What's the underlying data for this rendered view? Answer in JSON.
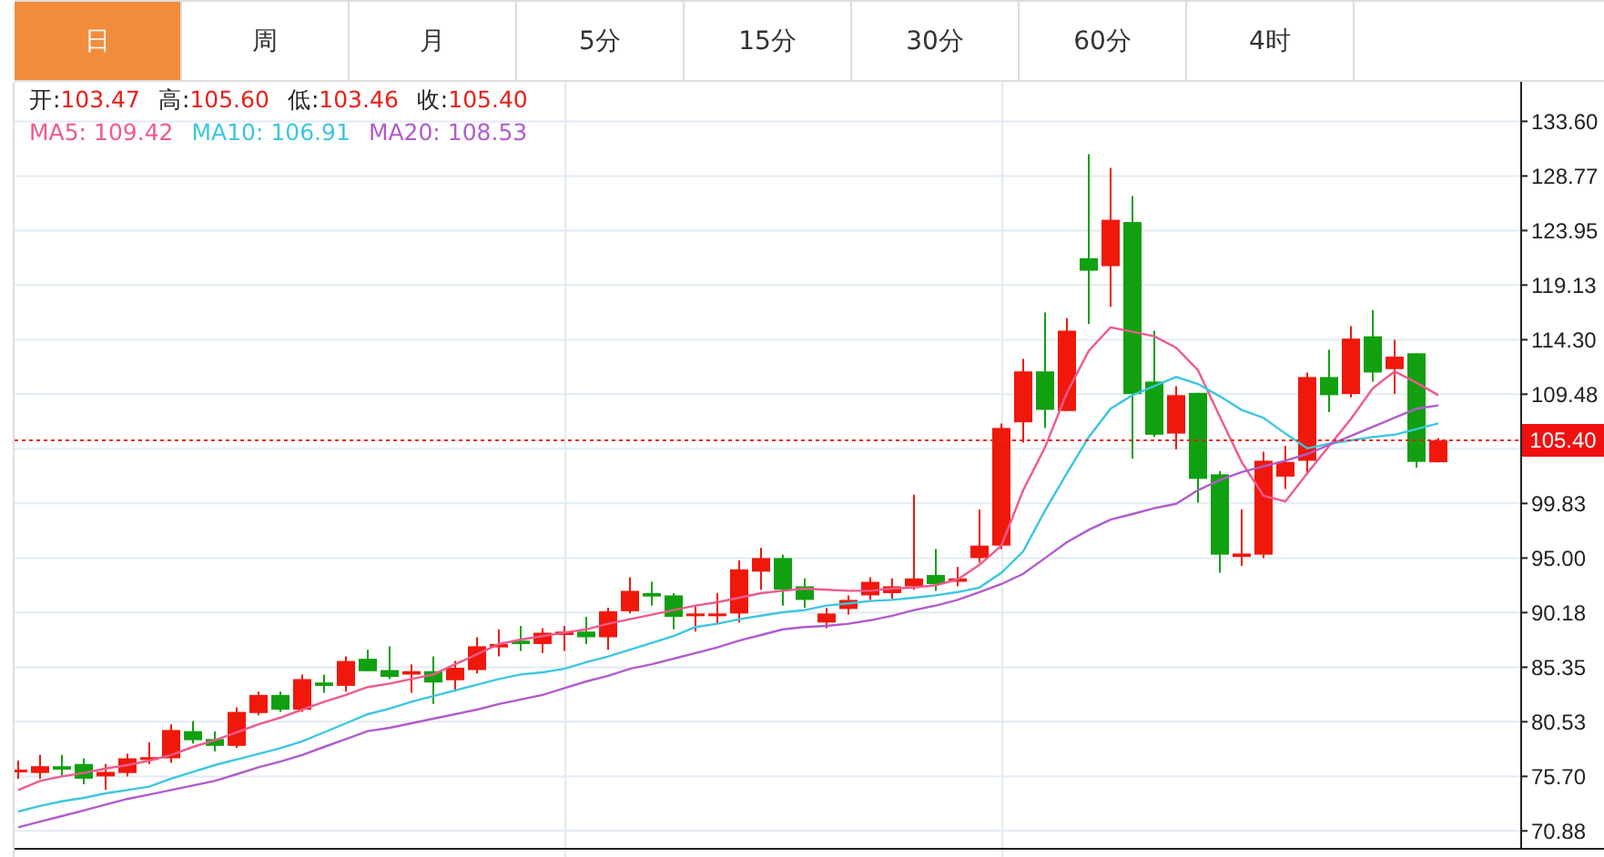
{
  "tabs": [
    {
      "label": "日",
      "selected": true
    },
    {
      "label": "周",
      "selected": false
    },
    {
      "label": "月",
      "selected": false
    },
    {
      "label": "5分",
      "selected": false
    },
    {
      "label": "15分",
      "selected": false
    },
    {
      "label": "30分",
      "selected": false
    },
    {
      "label": "60分",
      "selected": false
    },
    {
      "label": "4时",
      "selected": false
    }
  ],
  "ohlc": [
    {
      "label": "开:",
      "value": "103.47"
    },
    {
      "label": "高:",
      "value": "105.60"
    },
    {
      "label": "低:",
      "value": "103.46"
    },
    {
      "label": "收:",
      "value": "105.40"
    }
  ],
  "ma": [
    {
      "label": "MA5:",
      "value": "109.42",
      "color": "#ee5a8e"
    },
    {
      "label": "MA10:",
      "value": "106.91",
      "color": "#3cc6e0"
    },
    {
      "label": "MA20:",
      "value": "108.53",
      "color": "#b05ccc"
    }
  ],
  "chart": {
    "current_price": "105.40",
    "chart_data": {
      "type": "candlestick",
      "grid": true,
      "categories": [
        null,
        null,
        null,
        null,
        null,
        null,
        null,
        null,
        null,
        null,
        null,
        null,
        null,
        null,
        null,
        null,
        null,
        null,
        null,
        null,
        null,
        null,
        null,
        null,
        null,
        null,
        null,
        null,
        null,
        null,
        null,
        null,
        null,
        null,
        null,
        null,
        null,
        null,
        null,
        null,
        null,
        null,
        null,
        null,
        null,
        null,
        null,
        null,
        null,
        null,
        null,
        null,
        null,
        null,
        null,
        null,
        null,
        null,
        null,
        null,
        null,
        null,
        null,
        null,
        null,
        null
      ],
      "ohlc": [
        [
          76.1,
          77.1,
          75.5,
          76.3
        ],
        [
          76.0,
          77.6,
          75.5,
          76.6
        ],
        [
          76.6,
          77.6,
          75.8,
          76.3
        ],
        [
          76.8,
          77.3,
          75.0,
          75.5
        ],
        [
          75.7,
          76.8,
          74.5,
          76.1
        ],
        [
          76.0,
          77.7,
          75.7,
          77.3
        ],
        [
          77.3,
          78.7,
          76.8,
          77.4
        ],
        [
          77.3,
          80.3,
          76.9,
          79.8
        ],
        [
          79.7,
          80.6,
          78.6,
          78.9
        ],
        [
          79.0,
          79.7,
          77.9,
          78.4
        ],
        [
          78.4,
          81.8,
          78.2,
          81.4
        ],
        [
          81.3,
          83.2,
          81.1,
          82.9
        ],
        [
          82.9,
          83.2,
          81.4,
          81.6
        ],
        [
          81.6,
          84.7,
          81.4,
          84.3
        ],
        [
          84.0,
          84.7,
          83.1,
          83.7
        ],
        [
          83.7,
          86.3,
          83.2,
          85.9
        ],
        [
          86.1,
          86.9,
          85.0,
          85.0
        ],
        [
          85.1,
          87.2,
          84.3,
          84.5
        ],
        [
          84.7,
          85.6,
          83.1,
          85.0
        ],
        [
          85.0,
          86.3,
          82.1,
          84.0
        ],
        [
          84.2,
          85.9,
          83.2,
          85.3
        ],
        [
          85.1,
          88.0,
          84.8,
          87.2
        ],
        [
          87.1,
          88.7,
          86.3,
          87.4
        ],
        [
          87.7,
          89.0,
          86.8,
          87.4
        ],
        [
          87.4,
          88.8,
          86.6,
          88.4
        ],
        [
          88.2,
          89.0,
          86.8,
          88.5
        ],
        [
          88.5,
          89.8,
          87.4,
          88.0
        ],
        [
          88.0,
          90.6,
          86.9,
          90.3
        ],
        [
          90.3,
          93.3,
          90.1,
          92.1
        ],
        [
          91.9,
          92.9,
          90.8,
          91.6
        ],
        [
          91.7,
          91.9,
          88.7,
          89.8
        ],
        [
          90.0,
          90.8,
          88.5,
          90.1
        ],
        [
          90.0,
          91.9,
          89.2,
          90.1
        ],
        [
          90.1,
          94.8,
          89.3,
          94.0
        ],
        [
          93.8,
          95.9,
          92.2,
          95.0
        ],
        [
          95.0,
          95.3,
          90.8,
          92.2
        ],
        [
          92.5,
          93.2,
          90.6,
          91.3
        ],
        [
          89.3,
          90.6,
          88.8,
          90.1
        ],
        [
          90.5,
          91.7,
          90.0,
          91.3
        ],
        [
          91.7,
          93.3,
          91.3,
          92.9
        ],
        [
          91.9,
          93.2,
          91.4,
          92.5
        ],
        [
          92.5,
          100.6,
          92.2,
          93.2
        ],
        [
          93.5,
          95.8,
          92.1,
          92.7
        ],
        [
          92.9,
          94.2,
          92.5,
          93.2
        ],
        [
          95.0,
          99.3,
          94.6,
          96.1
        ],
        [
          96.1,
          106.9,
          95.8,
          106.5
        ],
        [
          107.0,
          112.6,
          105.2,
          111.5
        ],
        [
          111.5,
          116.7,
          106.5,
          108.1
        ],
        [
          108.0,
          116.2,
          108.0,
          115.1
        ],
        [
          121.5,
          130.7,
          115.7,
          120.4
        ],
        [
          120.8,
          129.5,
          117.2,
          124.9
        ],
        [
          124.7,
          127.0,
          103.8,
          109.5
        ],
        [
          110.6,
          115.1,
          105.7,
          105.9
        ],
        [
          106.0,
          110.2,
          104.6,
          109.4
        ],
        [
          109.6,
          109.6,
          99.9,
          102.0
        ],
        [
          102.4,
          102.7,
          93.7,
          95.3
        ],
        [
          95.1,
          99.3,
          94.3,
          95.4
        ],
        [
          95.3,
          104.4,
          95.0,
          103.6
        ],
        [
          102.2,
          104.9,
          101.1,
          103.5
        ],
        [
          103.6,
          111.4,
          102.5,
          111.0
        ],
        [
          111.0,
          113.4,
          107.9,
          109.4
        ],
        [
          109.5,
          115.5,
          109.2,
          114.4
        ],
        [
          114.6,
          116.9,
          110.6,
          111.4
        ],
        [
          111.7,
          114.3,
          109.5,
          112.8
        ],
        [
          113.1,
          113.1,
          103.0,
          103.5
        ],
        [
          103.47,
          105.6,
          103.46,
          105.4
        ]
      ],
      "series": [
        {
          "type": "line",
          "color": "#ee5a8e",
          "values": [
            74.5,
            75.3,
            75.7,
            76.0,
            76.4,
            76.7,
            77.1,
            77.6,
            78.3,
            78.9,
            79.6,
            80.3,
            80.9,
            81.6,
            82.3,
            82.9,
            83.6,
            83.9,
            84.3,
            84.7,
            85.6,
            86.5,
            87.4,
            87.8,
            88.1,
            88.4,
            88.7,
            89.2,
            89.6,
            90.0,
            90.4,
            90.8,
            91.1,
            91.5,
            91.9,
            92.1,
            92.3,
            92.2,
            92.1,
            92.1,
            92.3,
            92.4,
            92.6,
            93.1,
            94.4,
            96.1,
            101.0,
            104.8,
            109.6,
            113.3,
            115.4,
            115.0,
            114.6,
            113.6,
            111.6,
            107.5,
            103.5,
            100.5,
            100.0,
            102.5,
            104.9,
            107.3,
            110.0,
            111.5,
            110.5,
            109.4
          ]
        },
        {
          "type": "line",
          "color": "#3cc6e0",
          "values": [
            72.6,
            73.1,
            73.5,
            73.8,
            74.2,
            74.5,
            74.8,
            75.5,
            76.1,
            76.7,
            77.2,
            77.7,
            78.2,
            78.8,
            79.6,
            80.4,
            81.2,
            81.7,
            82.3,
            82.8,
            83.3,
            83.8,
            84.3,
            84.7,
            84.9,
            85.2,
            85.8,
            86.3,
            86.9,
            87.5,
            88.1,
            88.9,
            89.2,
            89.6,
            89.9,
            90.2,
            90.4,
            90.8,
            91.0,
            91.2,
            91.3,
            91.5,
            91.7,
            92.0,
            92.4,
            93.7,
            95.6,
            99.2,
            102.5,
            105.7,
            108.2,
            109.4,
            110.2,
            111.0,
            110.4,
            109.3,
            108.1,
            107.4,
            106.0,
            104.7,
            105.1,
            105.4,
            105.7,
            105.9,
            106.4,
            106.9
          ]
        },
        {
          "type": "line",
          "color": "#b05ccc",
          "values": [
            71.2,
            71.7,
            72.2,
            72.7,
            73.2,
            73.7,
            74.1,
            74.5,
            74.9,
            75.3,
            75.9,
            76.5,
            77.0,
            77.6,
            78.3,
            79.0,
            79.7,
            80.0,
            80.4,
            80.8,
            81.2,
            81.6,
            82.1,
            82.5,
            82.9,
            83.5,
            84.1,
            84.6,
            85.2,
            85.6,
            86.1,
            86.6,
            87.1,
            87.7,
            88.2,
            88.7,
            88.9,
            89.0,
            89.2,
            89.5,
            89.9,
            90.4,
            90.8,
            91.3,
            92.0,
            92.7,
            93.6,
            95.0,
            96.4,
            97.5,
            98.4,
            98.9,
            99.4,
            99.8,
            101.0,
            101.9,
            102.6,
            103.1,
            103.6,
            104.2,
            105.0,
            105.8,
            106.6,
            107.4,
            108.2,
            108.5
          ]
        }
      ],
      "ref_lines": [
        {
          "axis": "y",
          "value": 105.4
        }
      ],
      "ylim": [
        69.38,
        137.09
      ],
      "yticks": [
        {
          "value": 133.6,
          "label": "133.60"
        },
        {
          "value": 128.77,
          "label": "128.77"
        },
        {
          "value": 123.95,
          "label": "123.95"
        },
        {
          "value": 119.13,
          "label": "119.13"
        },
        {
          "value": 114.3,
          "label": "114.30"
        },
        {
          "value": 109.48,
          "label": "109.48"
        },
        {
          "value": 99.83,
          "label": "99.83"
        },
        {
          "value": 95,
          "label": "95.00"
        },
        {
          "value": 90.18,
          "label": "90.18"
        },
        {
          "value": 85.35,
          "label": "85.35"
        },
        {
          "value": 80.53,
          "label": "80.53"
        },
        {
          "value": 75.7,
          "label": "75.70"
        },
        {
          "value": 70.88,
          "label": "70.88"
        }
      ]
    }
  }
}
